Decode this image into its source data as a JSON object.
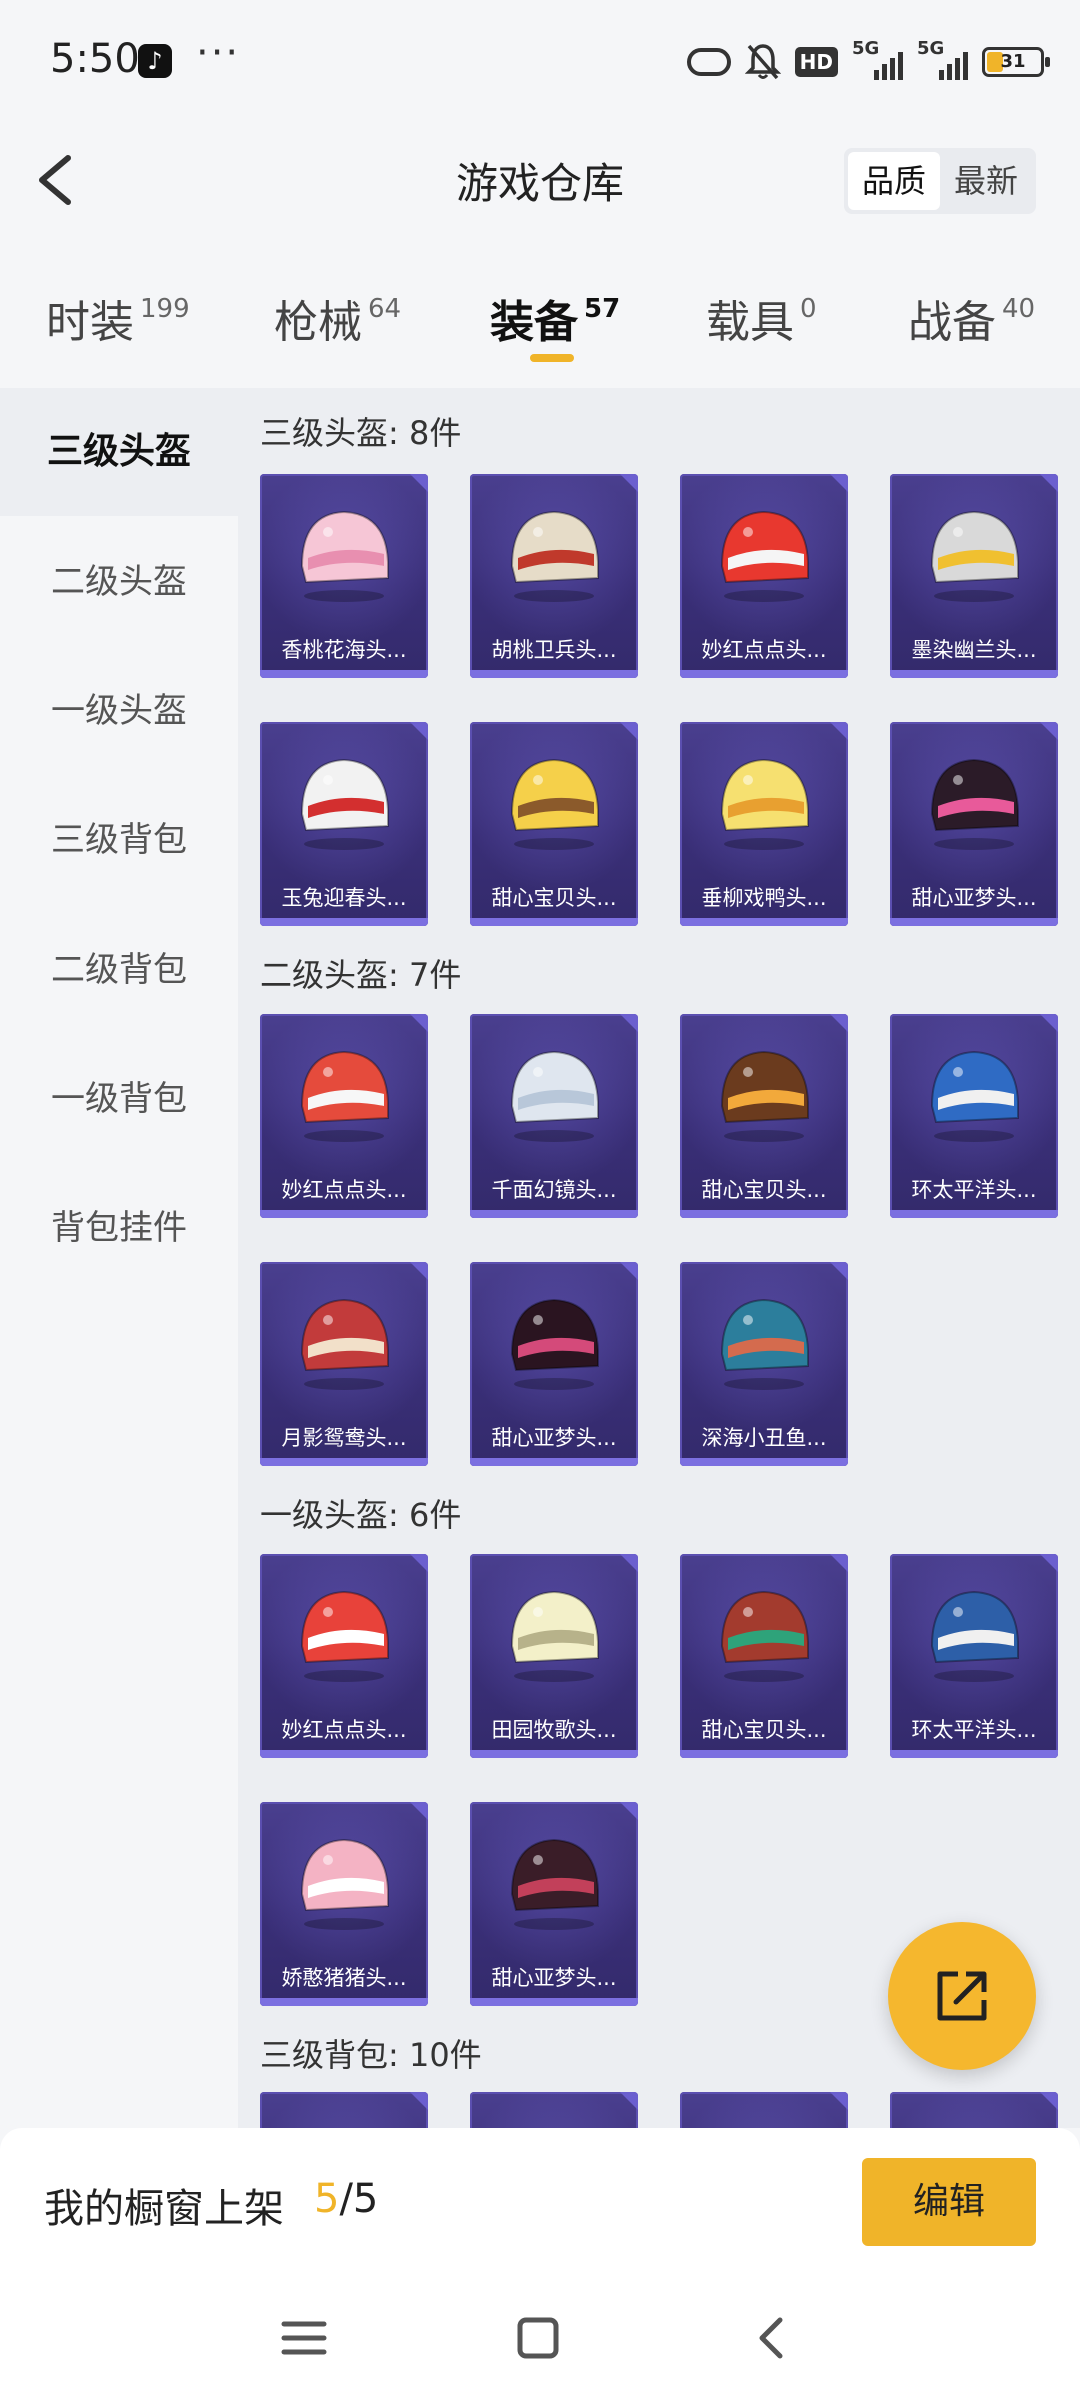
{
  "status_bar": {
    "time": "5:50",
    "dots": "···",
    "hd": "HD",
    "network_1": "5G",
    "network_2": "5G",
    "battery": "31",
    "app_icon": "tiktok-icon"
  },
  "header": {
    "title": "游戏仓库",
    "sort_options": [
      "品质",
      "最新"
    ],
    "active_sort": "品质"
  },
  "tabs": [
    {
      "label": "时装",
      "count": "199"
    },
    {
      "label": "枪械",
      "count": "64"
    },
    {
      "label": "装备",
      "count": "57"
    },
    {
      "label": "载具",
      "count": "0"
    },
    {
      "label": "战备",
      "count": "40"
    }
  ],
  "active_tab": "装备",
  "sidebar": {
    "items": [
      "三级头盔",
      "二级头盔",
      "一级头盔",
      "三级背包",
      "二级背包",
      "一级背包",
      "背包挂件"
    ],
    "active": "三级头盔"
  },
  "sections": [
    {
      "title": "三级头盔: 8件",
      "items": [
        "香桃花海头...",
        "胡桃卫兵头...",
        "妙红点点头...",
        "墨染幽兰头...",
        "玉兔迎春头...",
        "甜心宝贝头...",
        "垂柳戏鸭头...",
        "甜心亚梦头..."
      ]
    },
    {
      "title": "二级头盔: 7件",
      "items": [
        "妙红点点头...",
        "千面幻镜头...",
        "甜心宝贝头...",
        "环太平洋头...",
        "月影鸳鸯头...",
        "甜心亚梦头...",
        "深海小丑鱼..."
      ]
    },
    {
      "title": "一级头盔: 6件",
      "items": [
        "妙红点点头...",
        "田园牧歌头...",
        "甜心宝贝头...",
        "环太平洋头...",
        "娇憨猪猪头...",
        "甜心亚梦头..."
      ]
    },
    {
      "title": "三级背包: 10件",
      "items": []
    }
  ],
  "colors": {
    "accent": "#f0b429",
    "card_bg": "#3a2f78",
    "card_border": "#7b6fe0"
  },
  "bottom": {
    "showcase_label": "我的橱窗上架",
    "showcase_current": "5",
    "showcase_total": "/5",
    "edit_label": "编辑"
  }
}
